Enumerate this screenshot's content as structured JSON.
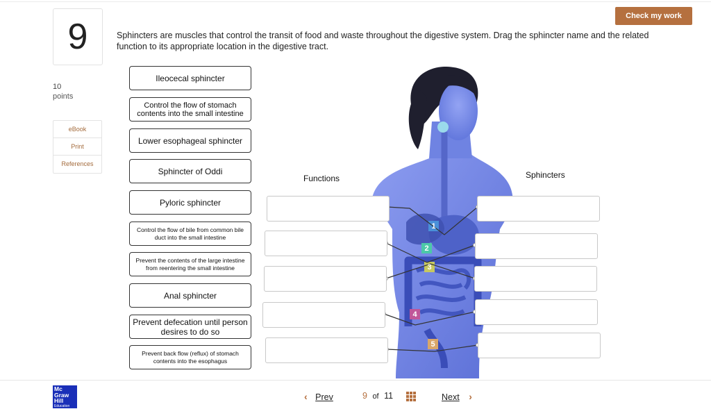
{
  "question": {
    "number": "9",
    "points_value": "10",
    "points_label": "points",
    "instructions": "Sphincters are muscles that control the transit of food and waste throughout the digestive system. Drag the sphincter name and the related function to its appropriate location in the digestive tract."
  },
  "sidebar": {
    "links": [
      {
        "label": "eBook"
      },
      {
        "label": "Print"
      },
      {
        "label": "References"
      }
    ]
  },
  "header": {
    "check_label": "Check my work"
  },
  "draggables": [
    {
      "label": "Ileocecal sphincter"
    },
    {
      "label": "Control the flow of stomach contents into the small intestine"
    },
    {
      "label": "Lower esophageal sphincter"
    },
    {
      "label": "Sphincter of Oddi"
    },
    {
      "label": "Pyloric sphincter"
    },
    {
      "label": "Control the flow of bile from common bile duct into the small intestine"
    },
    {
      "label": "Prevent the contents of the large intestine from reentering the small intestine"
    },
    {
      "label": "Anal sphincter"
    },
    {
      "label": "Prevent defecation until person desires to do so"
    },
    {
      "label": "Prevent back flow (reflux) of stomach contents into the esophagus"
    }
  ],
  "columns": {
    "functions_label": "Functions",
    "sphincters_label": "Sphincters"
  },
  "markers": [
    "1",
    "2",
    "3",
    "4",
    "5"
  ],
  "colors": {
    "accent": "#b5703f",
    "body_blue": "#6d82e0",
    "marker_1": "#4a90d9",
    "marker_2": "#4cc8a8",
    "marker_3": "#c6c860",
    "marker_4": "#c0569a",
    "marker_5": "#d9a76a"
  },
  "footer": {
    "logo_line1": "Mc",
    "logo_line2": "Graw",
    "logo_line3": "Hill",
    "logo_line4": "Education",
    "prev_label": "Prev",
    "current_page": "9",
    "of_label": "of",
    "total_pages": "11",
    "next_label": "Next"
  }
}
